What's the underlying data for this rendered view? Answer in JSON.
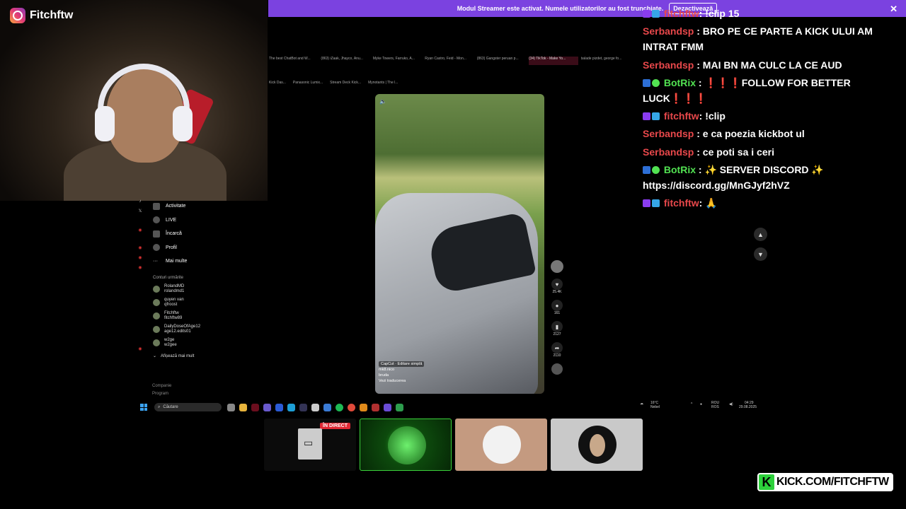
{
  "streamer": {
    "instagram_handle": "Fitchftw"
  },
  "banner": {
    "text": "Modul Streamer este activat. Numele utilizatorilor au fost trunchiate.",
    "button": "Dezactivează"
  },
  "browser": {
    "tabs": [
      "The best ChatBot and W...",
      "(863) iZaak, Jhayco, Anu...",
      "Myke Towers, Farruko, A...",
      "Ryan Castro, Feid - Mon...",
      "(863) Gangster peruan p...",
      "(34) TikTok - Make Yo...",
      "balade pizdet, george fo..."
    ],
    "bookmarks": [
      "Kick Das...",
      "Panasonic Lumix...",
      "Stream Deck Kick...",
      "Mynotants | The l..."
    ]
  },
  "tiktok": {
    "menu": [
      "Activitate",
      "LIVE",
      "Încarcă",
      "Profil",
      "Mai multe"
    ],
    "following_header": "Conturi urmărite",
    "following": [
      {
        "name": "RolandMD",
        "handle": "rolandmd1"
      },
      {
        "name": "quyen van",
        "handle": "qfroost"
      },
      {
        "name": "Fitchftw",
        "handle": "fitchftw89"
      },
      {
        "name": "DailyDoseOfAge12",
        "handle": "age12.edits01"
      },
      {
        "name": "w2ge",
        "handle": "w2gee"
      }
    ],
    "show_more": "Afișează mai mult",
    "footer": [
      "Companie",
      "Program"
    ],
    "video": {
      "edit_badge": "CapCut · Editare simplă",
      "author": "mk8.nico",
      "caption": "bruda",
      "translate": "Vezi traducerea"
    },
    "counts": {
      "likes": "25.4K",
      "comments": "161",
      "saves": "2127",
      "shares": "2110"
    }
  },
  "taskbar": {
    "search": "Căutare",
    "weather_temp": "16°C",
    "weather_desc": "Nebel",
    "lang": "ROU",
    "lang2": "ROS",
    "time": "04:29",
    "date": "29.08.2025"
  },
  "thumbnails": {
    "live_badge": "ÎN DIRECT"
  },
  "chat": {
    "messages": [
      {
        "user": "fitchftw",
        "text": ": !clip 15",
        "badges": true
      },
      {
        "user": "Serbandsp",
        "text": ": BRO PE CE PARTE A KICK ULUI AM INTRAT FMM"
      },
      {
        "user": "Serbandsp",
        "text": ": MAI BN MA CULC LA CE AUD"
      },
      {
        "user": "BotRix",
        "text": ": ❗❗❗FOLLOW FOR BETTER LUCK❗❗❗",
        "bot": true
      },
      {
        "user": "fitchftw",
        "text": ": !clip",
        "badges": true
      },
      {
        "user": "Serbandsp",
        "text": ": e ca poezia kickbot ul"
      },
      {
        "user": "Serbandsp",
        "text": ": ce poti sa i ceri"
      },
      {
        "user": "BotRix",
        "text": ": ✨ SERVER DISCORD ✨ https://discord.gg/MnGJyf2hVZ",
        "bot": true
      },
      {
        "user": "fitchftw",
        "text": ": 🙏",
        "badges": true
      }
    ]
  },
  "brand": {
    "kick_url": "KICK.COM/FITCHFTW"
  },
  "colors": {
    "banner": "#7b42e0",
    "kick_green": "#2dd13b",
    "chat_user": "#e8484b",
    "bot_user": "#52e252"
  }
}
